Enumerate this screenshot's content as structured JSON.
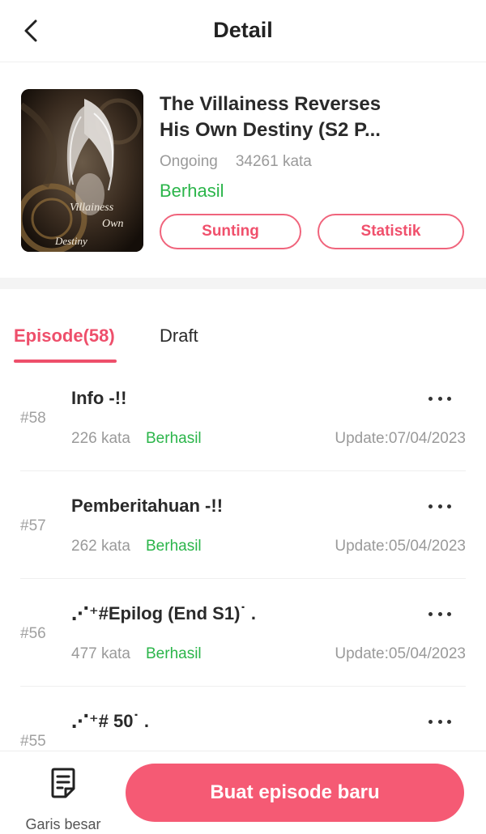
{
  "header": {
    "title": "Detail",
    "back_icon": "chevron-left-icon"
  },
  "book": {
    "title_line1": "The Villainess Reverses",
    "title_line2": "His Own Destiny (S2 P...",
    "status": "Ongoing",
    "word_count": "34261 kata",
    "review_status": "Berhasil",
    "edit_label": "Sunting",
    "stats_label": "Statistik",
    "cover_title_line1": "Villainess",
    "cover_title_line2": "Own",
    "cover_title_line3": "Destiny"
  },
  "tabs": {
    "episodes_label": "Episode(58)",
    "draft_label": "Draft"
  },
  "episodes": [
    {
      "number": "#58",
      "title": "Info -!!",
      "words": "226 kata",
      "status": "Berhasil",
      "update": "Update:07/04/2023"
    },
    {
      "number": "#57",
      "title": "Pemberitahuan -!!",
      "words": "262 kata",
      "status": "Berhasil",
      "update": "Update:05/04/2023"
    },
    {
      "number": "#56",
      "title": "⋰⁺#Epilog (End S1)˙ .",
      "words": "477 kata",
      "status": "Berhasil",
      "update": "Update:05/04/2023"
    },
    {
      "number": "#55",
      "title": "⋰⁺# 50˙ .",
      "words": "",
      "status": "",
      "update": ""
    }
  ],
  "bottom": {
    "outline_label": "Garis besar",
    "outline_icon": "document-list-icon",
    "new_episode_label": "Buat episode baru"
  },
  "colors": {
    "accent": "#f55a74",
    "success": "#2bb54a",
    "muted": "#9a9a9a"
  }
}
